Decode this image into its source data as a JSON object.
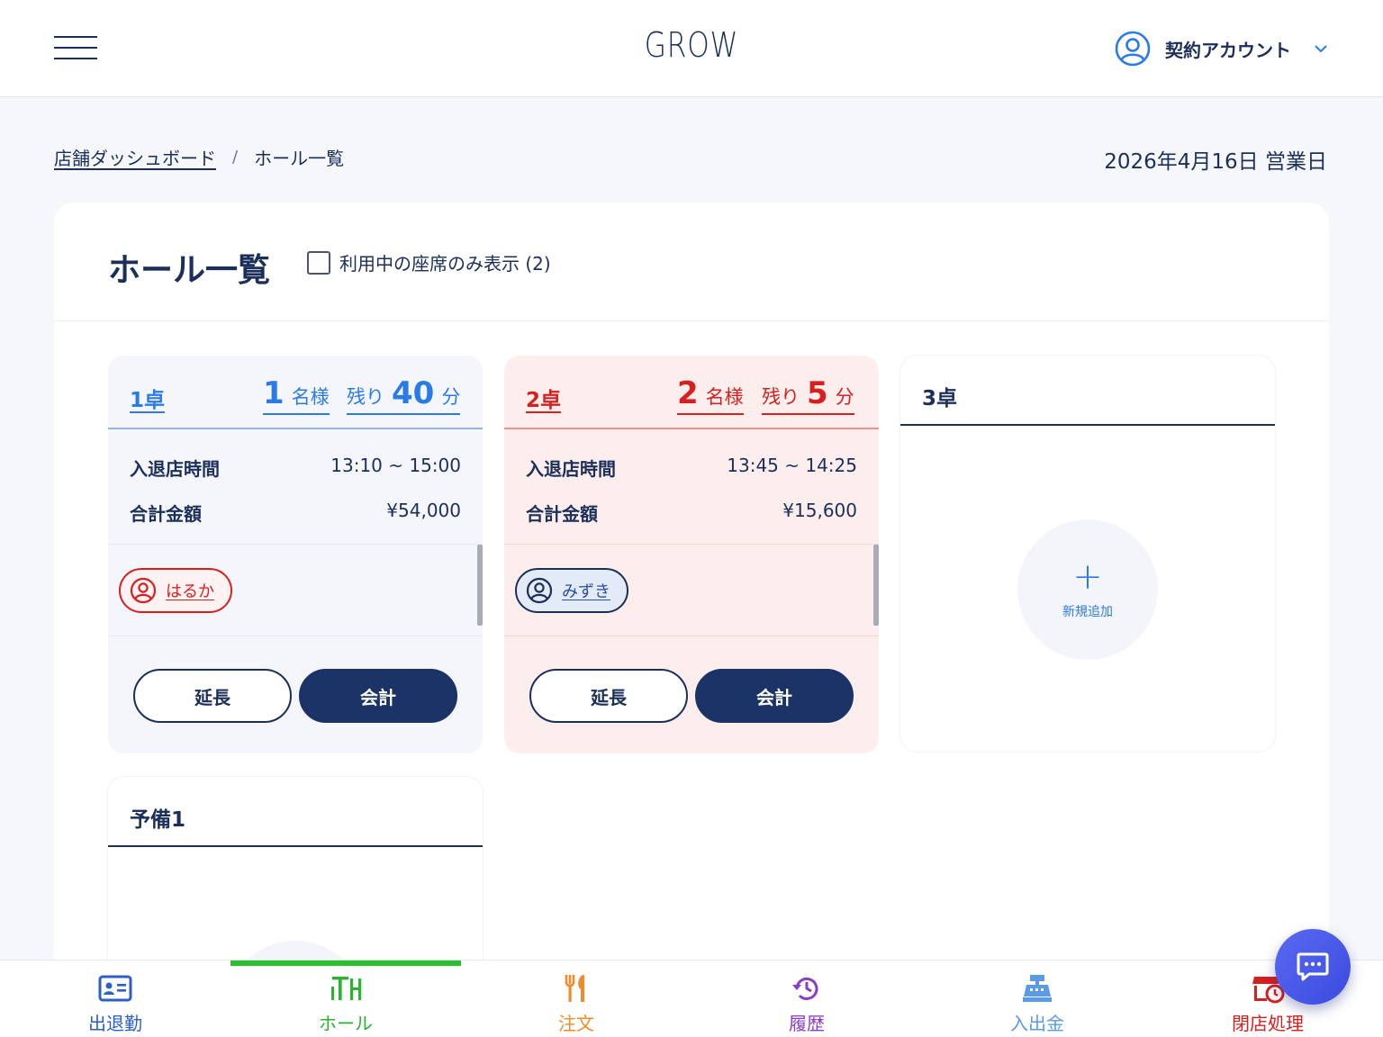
{
  "header": {
    "logo": "GROW",
    "account_name": "契約アカウント"
  },
  "breadcrumb": {
    "parent": "店舗ダッシュボード",
    "separator": "/",
    "current": "ホール一覧"
  },
  "business_date": "2026年4月16日 営業日",
  "panel": {
    "title": "ホール一覧",
    "filter_label": "利用中の座席のみ表示 (2)"
  },
  "tables": [
    {
      "name": "1卓",
      "guests": "1",
      "guests_unit": "名様",
      "remain_prefix": "残り",
      "remain": "40",
      "remain_unit": "分",
      "time_label": "入退店時間",
      "time_value": "13:10 ~ 15:00",
      "total_label": "合計金額",
      "total_value": "¥54,000",
      "cast": "はるか",
      "extend_label": "延長",
      "checkout_label": "会計"
    },
    {
      "name": "2卓",
      "guests": "2",
      "guests_unit": "名様",
      "remain_prefix": "残り",
      "remain": "5",
      "remain_unit": "分",
      "time_label": "入退店時間",
      "time_value": "13:45 ~ 14:25",
      "total_label": "合計金額",
      "total_value": "¥15,600",
      "cast": "みずき",
      "extend_label": "延長",
      "checkout_label": "会計"
    },
    {
      "name": "3卓",
      "add_label": "新規追加"
    },
    {
      "name": "予備1"
    }
  ],
  "bottom_nav": [
    {
      "label": "出退勤",
      "color": "#2b5fc7"
    },
    {
      "label": "ホール",
      "color": "#29b32e",
      "active": true
    },
    {
      "label": "注文",
      "color": "#f28a2a"
    },
    {
      "label": "履歴",
      "color": "#8a3ec6"
    },
    {
      "label": "入出金",
      "color": "#5a9ae6"
    },
    {
      "label": "閉店処理",
      "color": "#d81f1f"
    }
  ],
  "colors": {
    "navy": "#1b2f5a",
    "blue": "#2b7be6",
    "red": "#d81f1f",
    "active_tab": "#29c22e"
  }
}
